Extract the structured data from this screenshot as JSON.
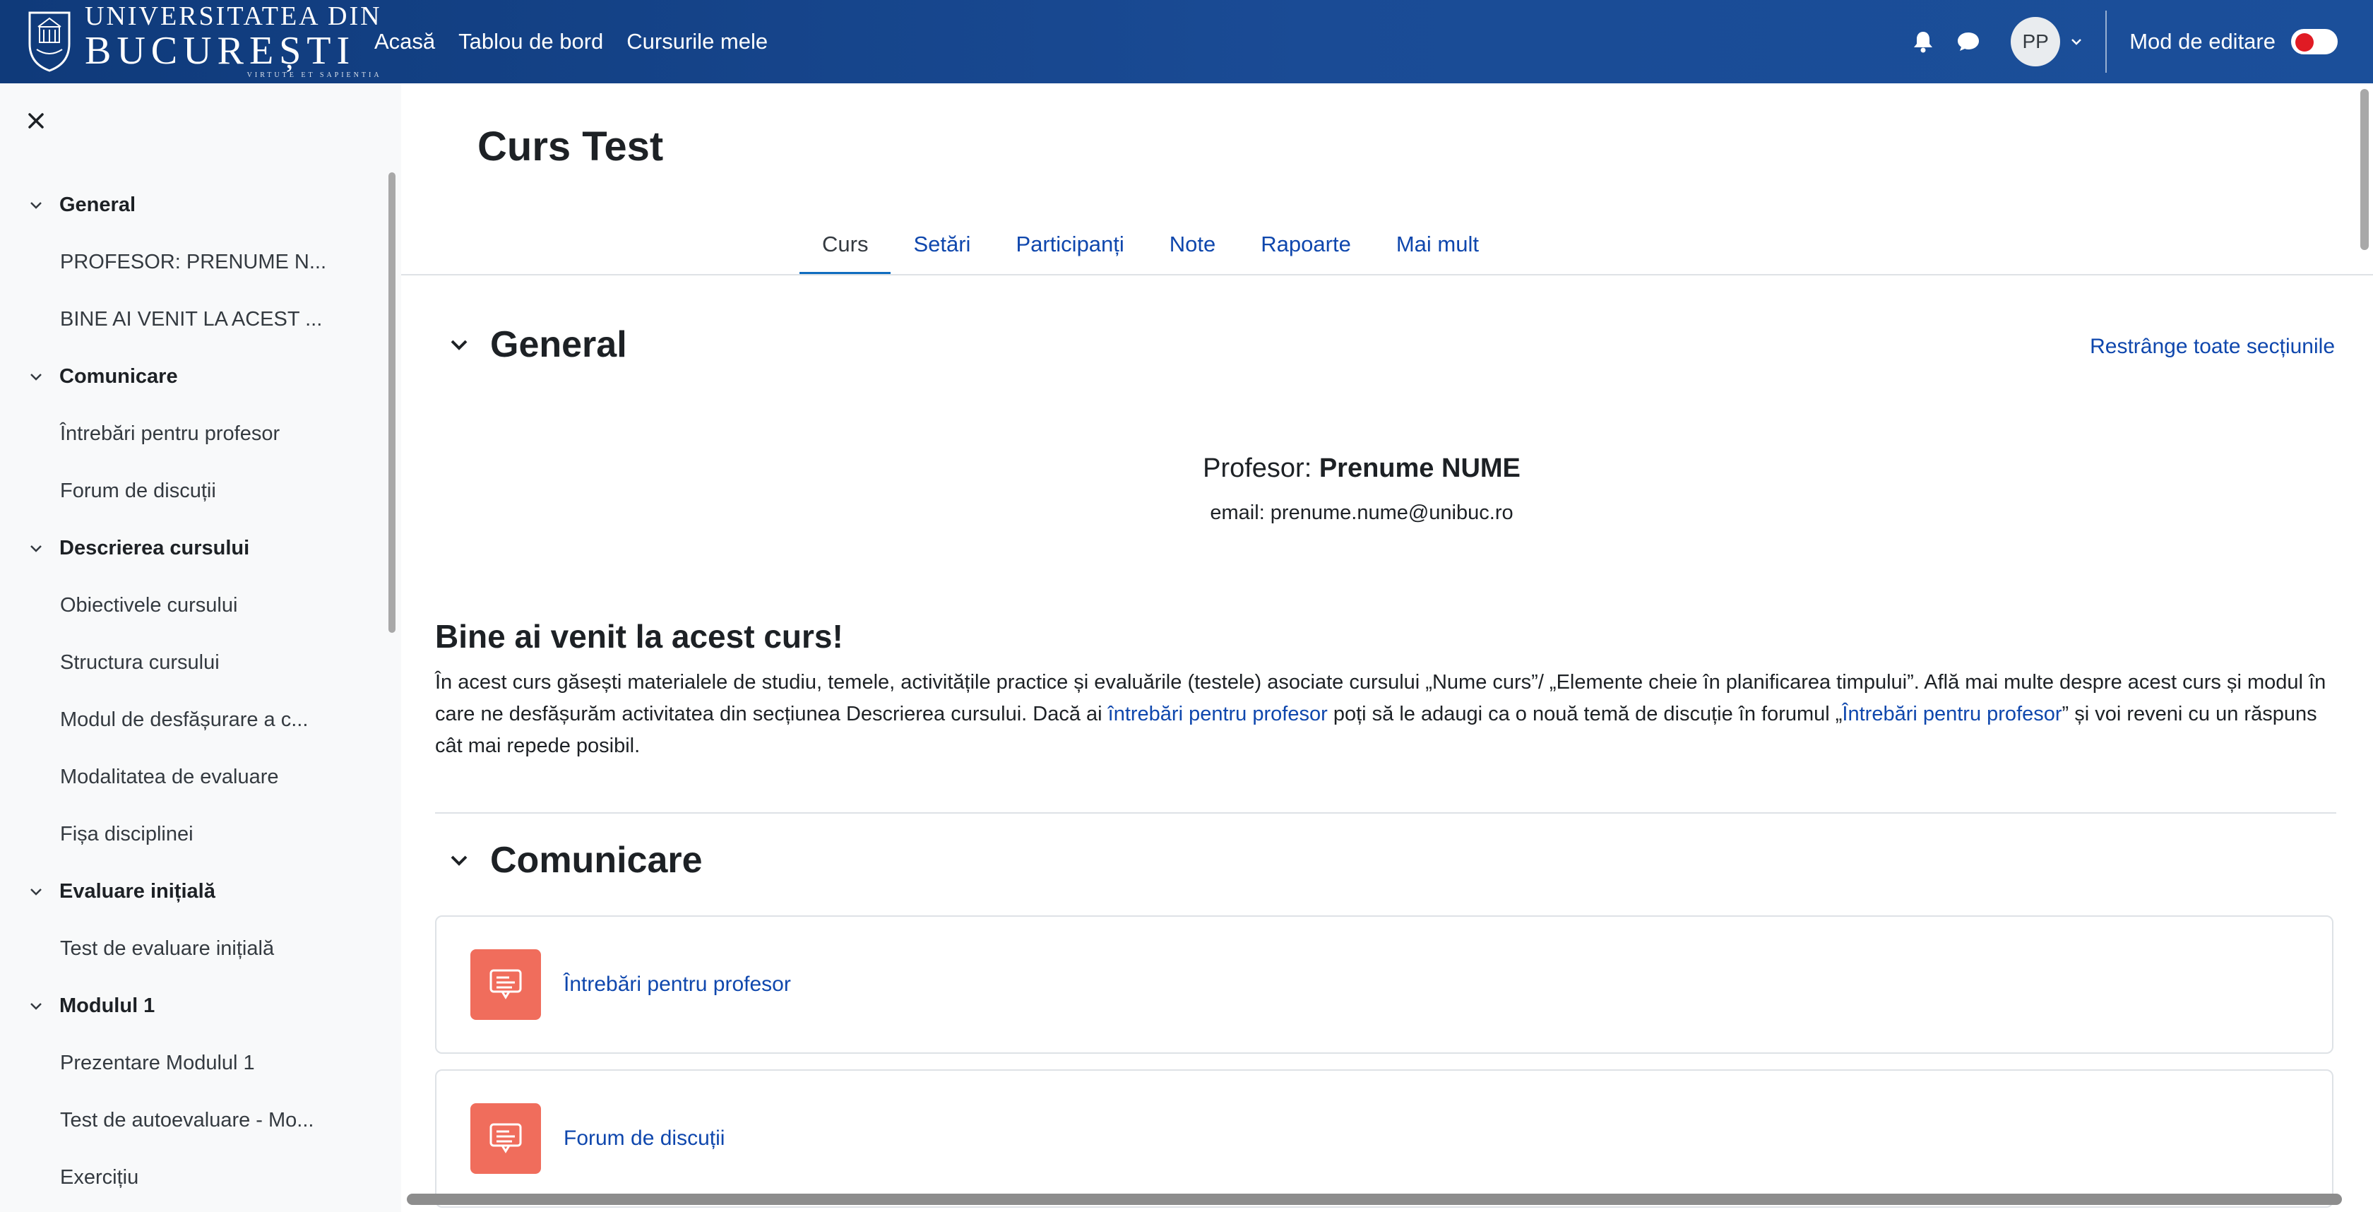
{
  "brand": {
    "line1": "Universitatea din",
    "line2": "București",
    "motto": "Virtute et Sapientia"
  },
  "topnav": {
    "items": [
      "Acasă",
      "Tablou de bord",
      "Cursurile mele"
    ]
  },
  "user": {
    "initials": "PP",
    "edit_mode_label": "Mod de editare",
    "edit_mode_on": false
  },
  "drawer": {
    "items": [
      {
        "type": "section",
        "label": "General"
      },
      {
        "type": "activity",
        "label": "PROFESOR: PRENUME N..."
      },
      {
        "type": "activity",
        "label": "BINE AI VENIT LA ACEST ..."
      },
      {
        "type": "section",
        "label": "Comunicare"
      },
      {
        "type": "activity",
        "label": "Întrebări pentru profesor"
      },
      {
        "type": "activity",
        "label": "Forum de discuții"
      },
      {
        "type": "section",
        "label": "Descrierea cursului"
      },
      {
        "type": "activity",
        "label": "Obiectivele cursului"
      },
      {
        "type": "activity",
        "label": "Structura cursului"
      },
      {
        "type": "activity",
        "label": "Modul de desfășurare a c..."
      },
      {
        "type": "activity",
        "label": "Modalitatea de evaluare"
      },
      {
        "type": "activity",
        "label": "Fișa disciplinei"
      },
      {
        "type": "section",
        "label": "Evaluare inițială"
      },
      {
        "type": "activity",
        "label": "Test de evaluare inițială"
      },
      {
        "type": "section",
        "label": "Modulul 1"
      },
      {
        "type": "activity",
        "label": "Prezentare Modulul 1"
      },
      {
        "type": "activity",
        "label": "Test de autoevaluare - Mo..."
      },
      {
        "type": "activity",
        "label": "Exercițiu"
      }
    ]
  },
  "course": {
    "title": "Curs Test",
    "tabs": [
      "Curs",
      "Setări",
      "Participanți",
      "Note",
      "Rapoarte",
      "Mai mult"
    ],
    "active_tab": "Curs",
    "collapse_all": "Restrânge toate secțiunile"
  },
  "general": {
    "title": "General",
    "professor_label": "Profesor:",
    "professor_name": "Prenume NUME",
    "email": "email: prenume.nume@unibuc.ro",
    "welcome_title": "Bine ai venit la acest curs!",
    "welcome_text_1": "În acest curs găsești materialele de studiu, temele, activitățile practice și evaluările (testele) asociate cursului „Nume curs”/ „Elemente cheie în planificarea timpului”. Află mai multe despre acest curs și modul în care ne desfășurăm activitatea din secțiunea Descrierea cursului. Dacă ai ",
    "welcome_link_1": "întrebări pentru profesor",
    "welcome_text_2": " poți să le adaugi ca o nouă temă de discuție în forumul „",
    "welcome_link_2": "Întrebări pentru profesor",
    "welcome_text_3": "” și voi reveni cu un răspuns cât mai repede posibil."
  },
  "communication": {
    "title": "Comunicare",
    "activities": [
      "Întrebări pentru profesor",
      "Forum de discuții"
    ]
  }
}
